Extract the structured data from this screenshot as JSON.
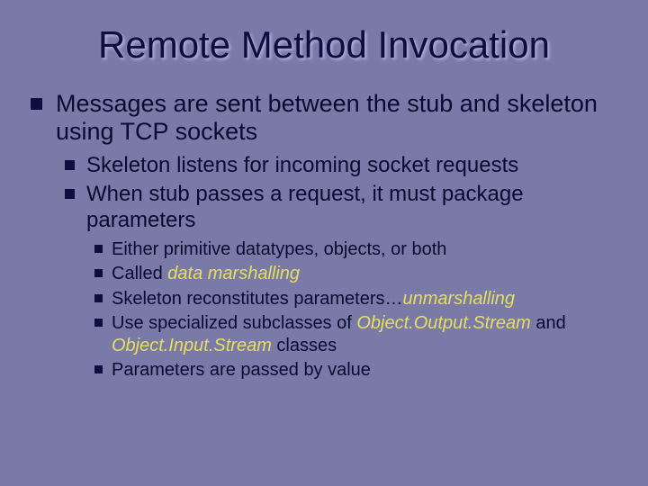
{
  "title": "Remote Method Invocation",
  "lvl1": {
    "item0": "Messages are sent between the stub and skeleton using TCP sockets"
  },
  "lvl2": {
    "item0": "Skeleton listens for incoming socket requests",
    "item1": "When stub passes a request, it must package parameters"
  },
  "lvl3": {
    "item0": "Either primitive datatypes, objects, or both",
    "item1_pre": "Called ",
    "item1_em": "data marshalling",
    "item2_pre": "Skeleton reconstitutes parameters…",
    "item2_em": "unmarshalling",
    "item3_pre": "Use specialized subclasses of ",
    "item3_em1": "Object.Output.Stream",
    "item3_mid": " and ",
    "item3_em2": "Object.Input.Stream",
    "item3_post": " classes",
    "item4": "Parameters are passed by value"
  }
}
